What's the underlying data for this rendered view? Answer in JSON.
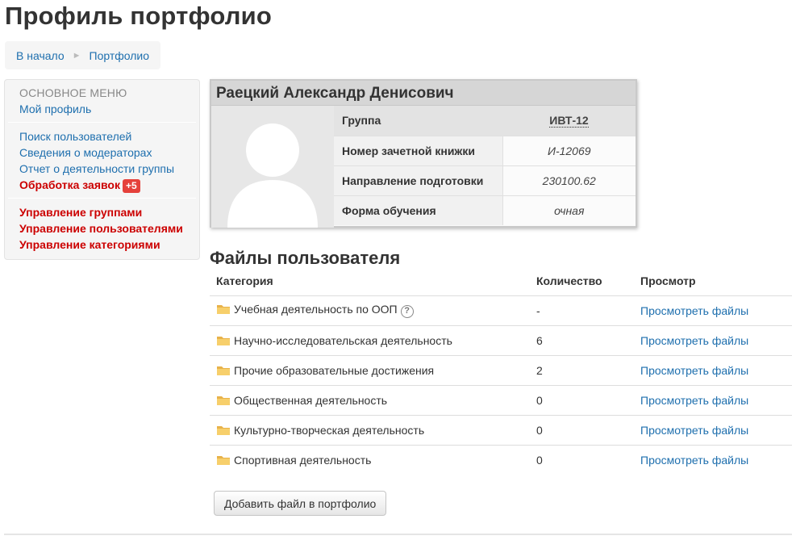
{
  "page_title": "Профиль портфолио",
  "breadcrumb": {
    "home": "В начало",
    "separator": "►",
    "current": "Портфолио"
  },
  "sidebar": {
    "header": "ОСНОВНОЕ МЕНЮ",
    "group1": [
      "Мой профиль"
    ],
    "group2": [
      "Поиск пользователей",
      "Сведения о модераторах",
      "Отчет о деятельности группы"
    ],
    "requests_label": "Обработка заявок",
    "requests_badge": "+5",
    "group3": [
      "Управление группами",
      "Управление пользователями",
      "Управление категориями"
    ]
  },
  "profile": {
    "name": "Раецкий Александр Денисович",
    "fields": [
      {
        "label": "Группа",
        "value": "ИВТ-12"
      },
      {
        "label": "Номер зачетной книжки",
        "value": "И-12069"
      },
      {
        "label": "Направление подготовки",
        "value": "230100.62"
      },
      {
        "label": "Форма обучения",
        "value": "очная"
      }
    ]
  },
  "files": {
    "title": "Файлы пользователя",
    "columns": [
      "Категория",
      "Количество",
      "Просмотр"
    ],
    "rows": [
      {
        "category": "Учебная деятельность по ООП",
        "count": "-",
        "link": "Просмотреть файлы",
        "help": "?"
      },
      {
        "category": "Научно-исследовательская деятельность",
        "count": "6",
        "link": "Просмотреть файлы"
      },
      {
        "category": "Прочие образовательные достижения",
        "count": "2",
        "link": "Просмотреть файлы"
      },
      {
        "category": "Общественная деятельность",
        "count": "0",
        "link": "Просмотреть файлы"
      },
      {
        "category": "Культурно-творческая деятельность",
        "count": "0",
        "link": "Просмотреть файлы"
      },
      {
        "category": "Спортивная деятельность",
        "count": "0",
        "link": "Просмотреть файлы"
      }
    ]
  },
  "add_button_label": "Добавить файл в портфолио",
  "colors": {
    "link": "#1e6fae",
    "admin_red": "#cc0000",
    "badge": "#e5413b",
    "folder": "#f3c25a"
  },
  "icons": {
    "folder": "folder-icon",
    "help": "help-icon",
    "avatar": "avatar-placeholder-icon",
    "breadcrumb_sep": "triangle-right-icon"
  }
}
